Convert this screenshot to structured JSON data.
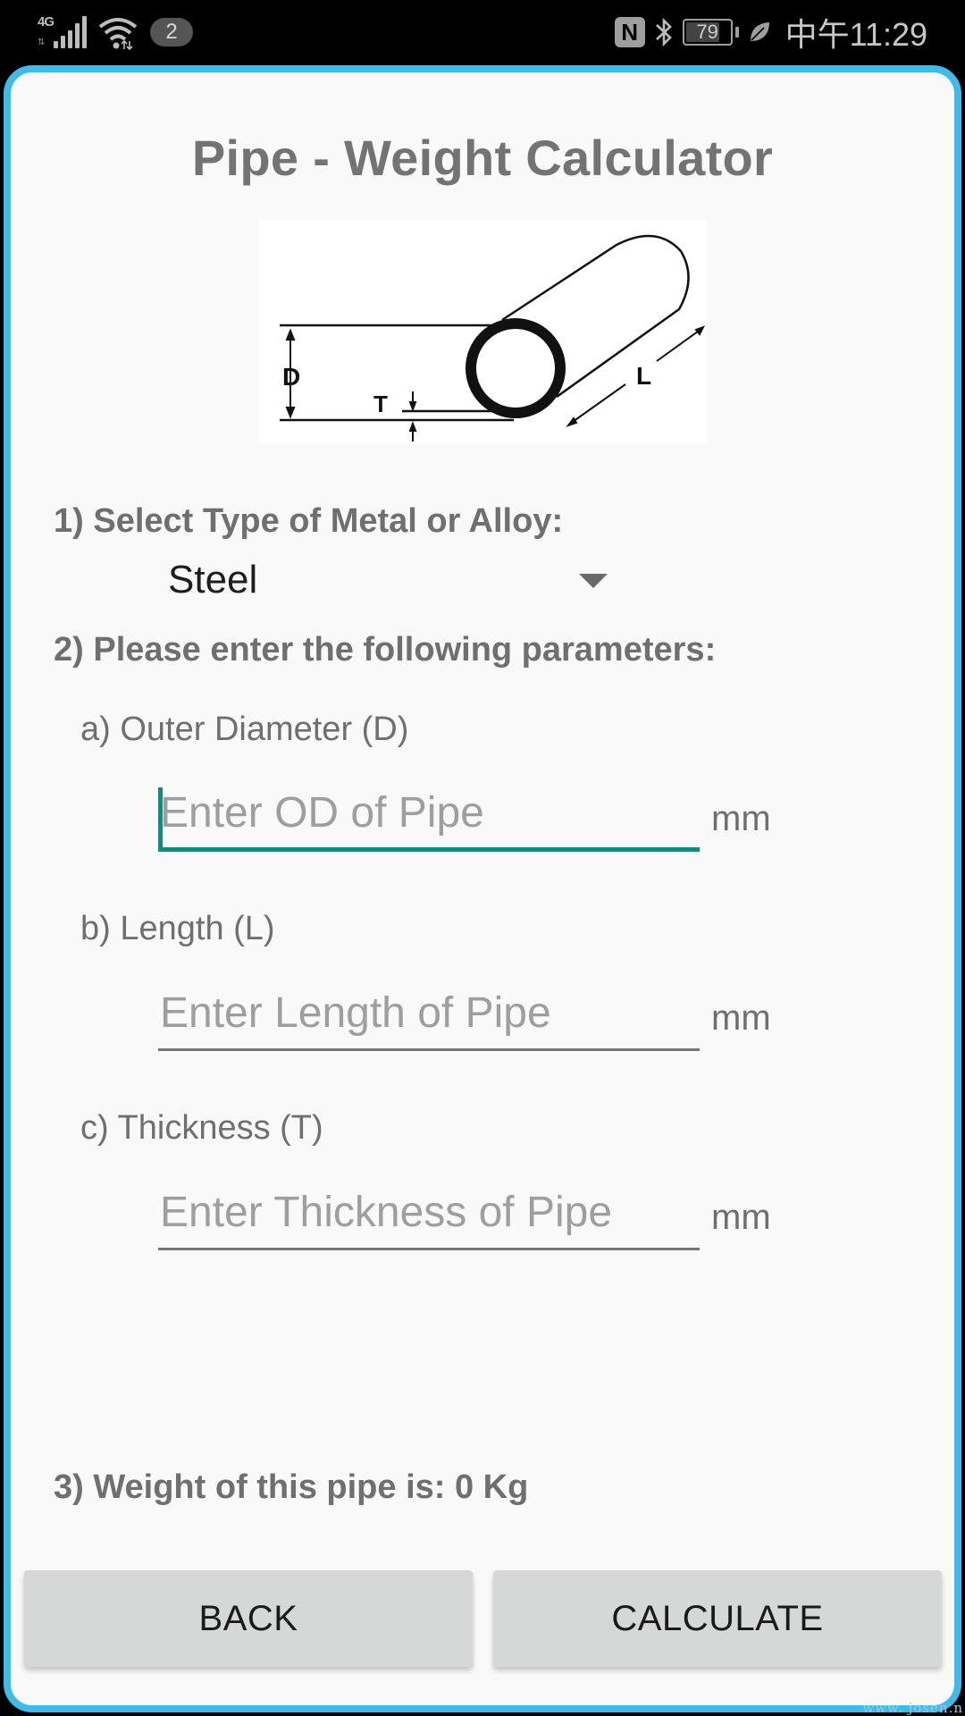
{
  "status_bar": {
    "network_label": "4G",
    "notification_count": "2",
    "nfc_label": "N",
    "bluetooth_glyph": "✱",
    "battery_percent": "79",
    "battery_level": 0.79,
    "clock": "中午11:29",
    "icons": [
      "signal-4g-icon",
      "wifi-icon",
      "nfc-icon",
      "bluetooth-icon",
      "battery-icon",
      "power-saving-leaf-icon"
    ]
  },
  "app": {
    "title": "Pipe - Weight Calculator",
    "diagram": {
      "labels": {
        "diameter": "D",
        "thickness": "T",
        "length": "L"
      }
    },
    "section1": {
      "label": "1) Select Type of Metal or Alloy:",
      "selected_metal": "Steel"
    },
    "section2": {
      "label": "2) Please enter the following parameters:",
      "params": [
        {
          "label": "a) Outer Diameter (D)",
          "placeholder": "Enter OD of Pipe",
          "value": "",
          "unit": "mm",
          "focused": true
        },
        {
          "label": "b) Length (L)",
          "placeholder": "Enter Length of Pipe",
          "value": "",
          "unit": "mm",
          "focused": false
        },
        {
          "label": "c) Thickness (T)",
          "placeholder": "Enter Thickness of Pipe",
          "value": "",
          "unit": "mm",
          "focused": false
        }
      ]
    },
    "section3": {
      "label": "3) Weight of this pipe is: 0 Kg"
    },
    "buttons": {
      "back": "BACK",
      "calculate": "CALCULATE"
    },
    "colors": {
      "frame_border": "#3dbcea",
      "focus_accent": "#138a7e",
      "button_bg": "#d6d7d7"
    }
  },
  "watermark": "www. josen.n"
}
